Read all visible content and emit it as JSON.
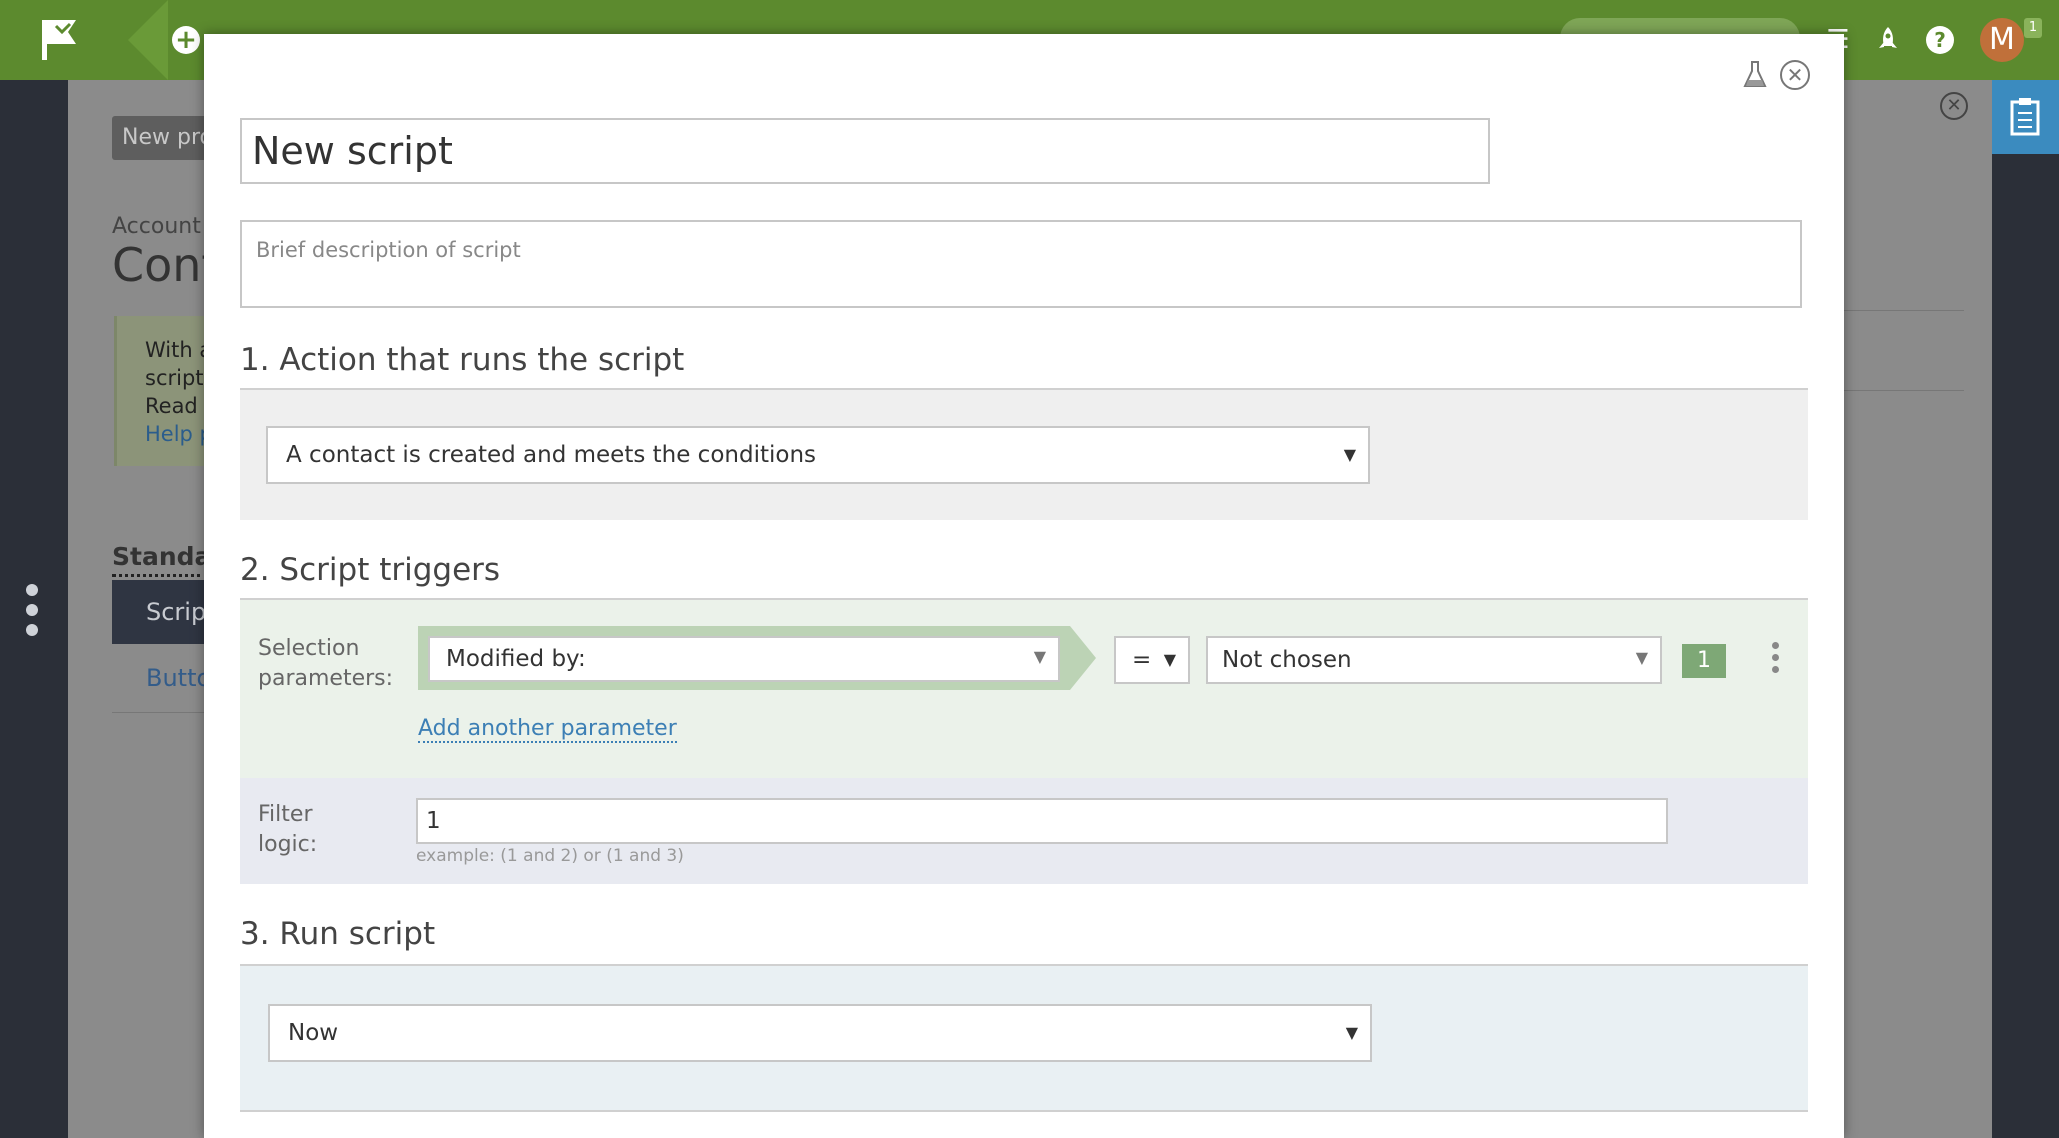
{
  "topbar": {
    "avatar_letter": "M",
    "notification_count": "1",
    "brand_color": "#5c8a2e"
  },
  "background": {
    "new_button": "New pro",
    "small_label": "Account m",
    "page_title": "Cont",
    "note_lines": [
      "With a",
      "scripts",
      "Read r",
      "Help p"
    ],
    "standard_label": "Standa",
    "tab_active": "Scrip",
    "tab_inactive": "Butto"
  },
  "modal": {
    "title_value": "New script",
    "description_placeholder": "Brief description of script",
    "section1": {
      "title": "1. Action that runs the script",
      "selected_action": "A contact is created and meets the conditions"
    },
    "section2": {
      "title": "2. Script triggers",
      "selection_label": "Selection\nparameters:",
      "selection_label_lines": [
        "Selection",
        "parameters:"
      ],
      "parameter_field": "Modified by:",
      "operator": "=",
      "parameter_value": "Not chosen",
      "parameter_index": "1",
      "add_parameter_link": "Add another parameter",
      "filter_label_lines": [
        "Filter",
        "logic:"
      ],
      "filter_value": "1",
      "filter_hint": "example: (1 and 2) or (1 and 3)"
    },
    "section3": {
      "title": "3. Run script",
      "run_option": "Now"
    }
  },
  "icons": [
    "flag-logo-icon",
    "plus-icon",
    "search-icon",
    "menu-icon",
    "rocket-icon",
    "help-icon",
    "flask-icon",
    "close-icon",
    "clipboard-icon",
    "kebab-icon",
    "dropdown-arrow-icon"
  ]
}
